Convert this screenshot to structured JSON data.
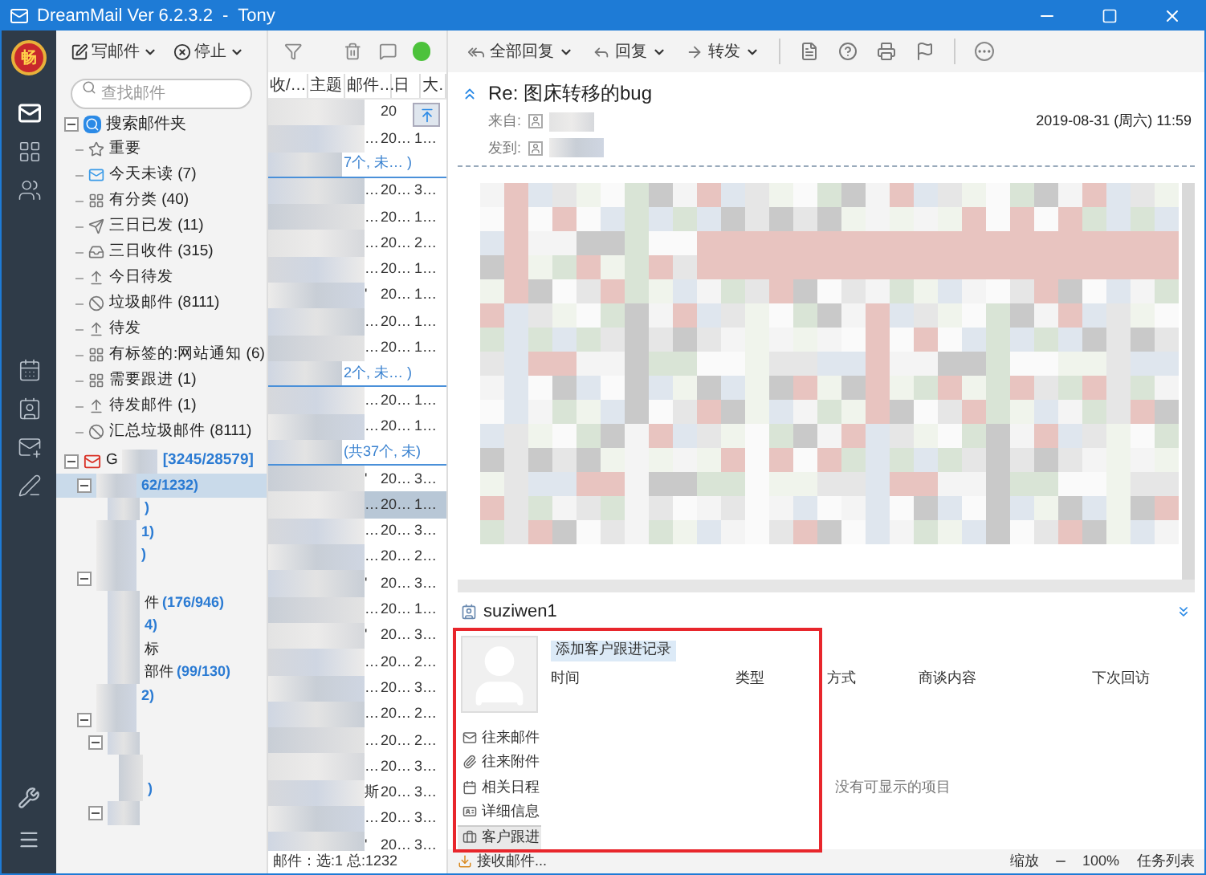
{
  "window": {
    "title": "DreamMail Ver 6.2.3.2  -  Tony"
  },
  "logo": {
    "text": "畅"
  },
  "rail": [
    {
      "kind": "mail",
      "selected": true
    },
    {
      "kind": "grid",
      "selected": false
    },
    {
      "kind": "contacts",
      "selected": false
    },
    {
      "kind": "calendar",
      "selected": false
    },
    {
      "kind": "card",
      "selected": false
    },
    {
      "kind": "send",
      "selected": false
    },
    {
      "kind": "pen",
      "selected": false
    }
  ],
  "folder_toolbar": {
    "compose": "写邮件",
    "stop": "停止"
  },
  "search": {
    "placeholder": "查找邮件"
  },
  "search_folders": {
    "label": "搜索邮件夹",
    "expanded": true,
    "children": [
      {
        "kind": "important",
        "label": "重要"
      },
      {
        "kind": "unread",
        "label": "今天未读 (7)"
      },
      {
        "kind": "grid",
        "label": "有分类 (40)"
      },
      {
        "kind": "sent",
        "label": "三日已发 (11)"
      },
      {
        "kind": "inbox",
        "label": "三日收件 (315)"
      },
      {
        "kind": "outbox",
        "label": "今日待发"
      },
      {
        "kind": "spam",
        "label": "垃圾邮件 (8111)"
      },
      {
        "kind": "outbox",
        "label": "待发"
      },
      {
        "kind": "grid",
        "label": "有标签的:网站通知 (6)"
      },
      {
        "kind": "grid",
        "label": "需要跟进 (1)"
      },
      {
        "kind": "outbox",
        "label": "待发邮件 (1)"
      },
      {
        "kind": "spam",
        "label": "汇总垃圾邮件 (8111)"
      }
    ]
  },
  "account": {
    "label": "G",
    "count": "[3245/28579]",
    "expanded": true,
    "children": [
      {
        "count": "62/1232)",
        "selected": true,
        "expanded": true,
        "children": [
          {
            "count": ")",
            "selected": false
          }
        ]
      },
      {
        "count": "1)",
        "selected": false
      },
      {
        "count": ")",
        "selected": false
      },
      {
        "selected": false,
        "expanded": true,
        "children": [
          {
            "label": "件",
            "count": "(176/946)",
            "selected": false
          },
          {
            "count": "4)",
            "selected": false
          },
          {
            "label": "标",
            "selected": false
          },
          {
            "label": "部件",
            "count": "(99/130)",
            "selected": false
          }
        ]
      },
      {
        "count": "2)",
        "selected": false
      },
      {
        "selected": false,
        "expanded": true,
        "children": [
          {
            "selected": false,
            "expanded": true,
            "children": [
              {
                "selected": false
              },
              {
                "count": ")",
                "selected": false
              }
            ]
          },
          {
            "selected": false,
            "expanded": true
          }
        ]
      }
    ]
  },
  "mail_list": {
    "columns": [
      "收/…",
      "主题",
      "邮件…",
      "日",
      "大."
    ],
    "rows": [
      {
        "kind": "mail",
        "date": "20",
        "selected": false
      },
      {
        "kind": "mail",
        "col_3": "…",
        "date": "20…",
        "size": "1…",
        "selected": false
      },
      {
        "kind": "group",
        "text": "7个, 未…  )"
      },
      {
        "kind": "mail",
        "col_3": "…",
        "date": "20…",
        "size": "3…",
        "selected": false
      },
      {
        "kind": "mail",
        "col_3": "…",
        "date": "20…",
        "size": "1…",
        "selected": false
      },
      {
        "kind": "mail",
        "col_3": "…",
        "date": "20…",
        "size": "2…",
        "selected": false
      },
      {
        "kind": "mail",
        "col_3": "…",
        "date": "20…",
        "size": "1…",
        "selected": false
      },
      {
        "kind": "mail",
        "col_3": "'",
        "date": "20…",
        "size": "1…",
        "selected": false
      },
      {
        "kind": "mail",
        "col_3": "…",
        "date": "20…",
        "size": "1…",
        "selected": false
      },
      {
        "kind": "mail",
        "col_3": "…",
        "date": "20…",
        "size": "1…",
        "selected": false
      },
      {
        "kind": "group",
        "text": "2个, 未…  )"
      },
      {
        "kind": "mail",
        "col_3": "…",
        "date": "20…",
        "size": "1…",
        "selected": false
      },
      {
        "kind": "mail",
        "col_3": "…",
        "date": "20…",
        "size": "1…",
        "selected": false
      },
      {
        "kind": "group",
        "text": "(共37个, 未)"
      },
      {
        "kind": "mail",
        "col_3": "'",
        "date": "20…",
        "size": "3…",
        "selected": false
      },
      {
        "kind": "mail",
        "col_3": "…",
        "date": "20…",
        "size": "1…",
        "selected": true
      },
      {
        "kind": "mail",
        "col_3": "…",
        "date": "20…",
        "size": "3…",
        "selected": false
      },
      {
        "kind": "mail",
        "col_3": "…",
        "date": "20…",
        "size": "2…",
        "selected": false
      },
      {
        "kind": "mail",
        "col_3": "'",
        "date": "20…",
        "size": "3…",
        "selected": false
      },
      {
        "kind": "mail",
        "col_3": "…",
        "date": "20…",
        "size": "1…",
        "selected": false
      },
      {
        "kind": "mail",
        "col_3": "'",
        "date": "20…",
        "size": "3…",
        "selected": false
      },
      {
        "kind": "mail",
        "col_3": "…",
        "date": "20…",
        "size": "2…",
        "selected": false
      },
      {
        "kind": "mail",
        "col_3": "…",
        "date": "20…",
        "size": "3…",
        "selected": false
      },
      {
        "kind": "mail",
        "col_3": "…",
        "date": "20…",
        "size": "2…",
        "selected": false
      },
      {
        "kind": "mail",
        "col_3": "…",
        "date": "20…",
        "size": "2…",
        "selected": false
      },
      {
        "kind": "mail",
        "col_3": "…",
        "date": "20…",
        "size": "3…",
        "selected": false
      },
      {
        "kind": "mail",
        "col_3": "斯",
        "date": "20…",
        "size": "3…",
        "selected": false
      },
      {
        "kind": "mail",
        "col_3": "…",
        "date": "20…",
        "size": "3…",
        "selected": false
      },
      {
        "kind": "mail",
        "col_3": "'",
        "date": "20…",
        "size": "3…",
        "selected": false
      }
    ],
    "status": "邮件：选:1 总:1232"
  },
  "reader_toolbar": [
    {
      "kind": "reply_all",
      "label": "全部回复"
    },
    {
      "kind": "reply",
      "label": "回复"
    },
    {
      "kind": "forward",
      "label": "转发"
    }
  ],
  "message": {
    "subject": "Re: 图床转移的bug",
    "from_label": "来自:",
    "to_label": "发到:",
    "date": "2019-08-31 (周六) 11:59"
  },
  "contact": {
    "name": "suziwen1",
    "add_button": "添加客户跟进记录",
    "menu": [
      {
        "kind": "mail",
        "label": "往来邮件",
        "selected": false
      },
      {
        "kind": "attach",
        "label": "往来附件",
        "selected": false
      },
      {
        "kind": "calendar",
        "label": "相关日程",
        "selected": false
      },
      {
        "kind": "card",
        "label": "详细信息",
        "selected": false
      },
      {
        "kind": "follow",
        "label": "客户跟进",
        "selected": true
      }
    ],
    "columns": [
      "时间",
      "类型",
      "方式",
      "商谈内容",
      "下次回访"
    ],
    "empty": "没有可显示的项目"
  },
  "status_bar": {
    "task": "接收邮件...",
    "zoom_label": "缩放",
    "zoom_value": "100%",
    "tasks": "任务列表"
  }
}
